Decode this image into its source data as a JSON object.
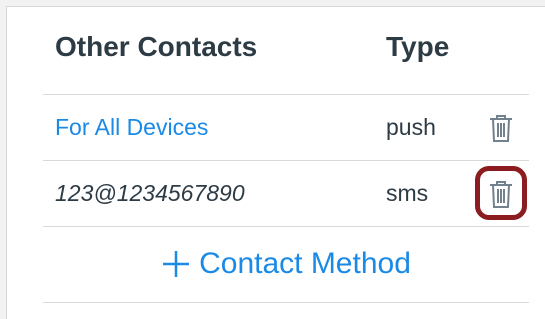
{
  "table": {
    "headers": {
      "name": "Other Contacts",
      "type": "Type"
    },
    "rows": [
      {
        "name": "For All Devices",
        "type": "push",
        "name_is_link": true,
        "action_icon": "trash-icon"
      },
      {
        "name": "123@1234567890",
        "type": "sms",
        "name_is_link": false,
        "action_icon": "trash-icon",
        "highlighted": true
      }
    ]
  },
  "add_contact": {
    "label": "Contact Method",
    "icon": "plus-icon"
  },
  "colors": {
    "link": "#1a8ae6",
    "text": "#2d3b45",
    "highlight": "#8b1c1f",
    "icon": "#73818c"
  }
}
